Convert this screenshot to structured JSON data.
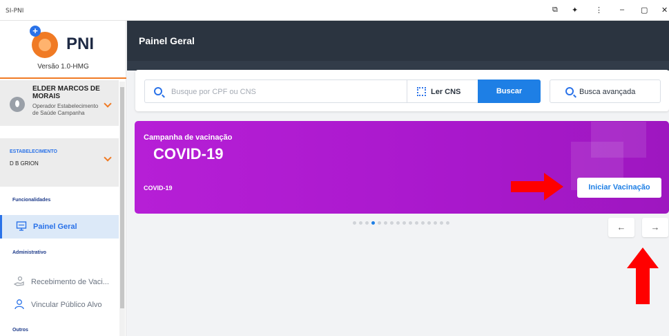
{
  "window": {
    "title": "SI-PNI",
    "controls": [
      "⧉",
      "✦",
      "⋮",
      "–",
      "▢",
      "✕"
    ]
  },
  "sidebar": {
    "logo_text": "PNI",
    "version": "Versão 1.0-HMG",
    "user": {
      "name": "ELDER MARCOS DE MORAIS",
      "role": "Operador Estabelecimento de Saúde Campanha"
    },
    "establishment": {
      "label": "ESTABELECIMENTO",
      "value": "D B GRION"
    },
    "sections": {
      "funcionalidades": "Funcionalidades",
      "administrativo": "Administrativo",
      "outros": "Outros"
    },
    "items": [
      {
        "label": "Painel Geral",
        "icon": "monitor-icon",
        "active": true
      },
      {
        "label": "Recebimento de Vaci...",
        "icon": "hand-receive-icon",
        "active": false
      },
      {
        "label": "Vincular Público Alvo",
        "icon": "user-icon",
        "active": false
      }
    ]
  },
  "header": {
    "title": "Painel Geral"
  },
  "search": {
    "placeholder": "Busque por CPF ou CNS",
    "read_cns_label": "Ler CNS",
    "search_label": "Buscar",
    "advanced_label": "Busca avançada"
  },
  "banner": {
    "subtitle": "Campanha de vacinação",
    "title": "COVID-19",
    "tag": "COVID-19",
    "start_label": "Iniciar Vacinação"
  },
  "carousel": {
    "dot_count": 16,
    "active_index": 3,
    "prev_label": "←",
    "next_label": "→"
  },
  "colors": {
    "accent": "#1e7fe5",
    "header_bg": "#2b3440",
    "banner_bg": "#b61fd6",
    "logo_orange": "#f07a24",
    "annotation_red": "#ff0000"
  }
}
